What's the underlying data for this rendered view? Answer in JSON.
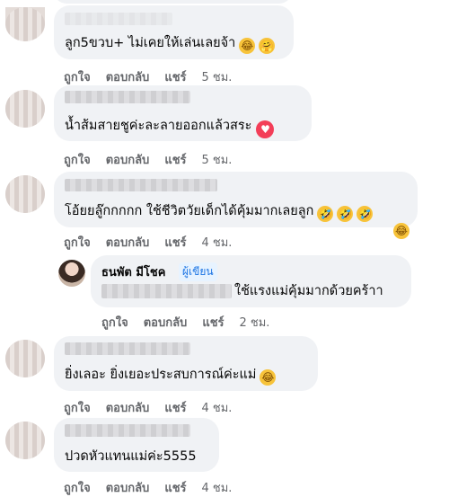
{
  "comments": [
    {
      "text": "ลูก5ขวบ+ ไม่เคยให้เล่นเลยจ้า",
      "emojis": [
        "laughing-face",
        "hugging-face"
      ],
      "actions": {
        "like": "ถูกใจ",
        "reply": "ตอบกลับ",
        "share": "แชร์",
        "time": "5 ชม."
      }
    },
    {
      "text": "น้ำส้มสายชูค่ะละลายออกแล้วสระ",
      "emojis": [
        "heart-reaction"
      ],
      "actions": {
        "like": "ถูกใจ",
        "reply": "ตอบกลับ",
        "share": "แชร์",
        "time": "5 ชม."
      }
    },
    {
      "text": "โอ้ยยลู๊กกกกก ใช้ชีวิตวัยเด็กได้คุ้มมากเลยลูก",
      "emojis": [
        "rolling-laughing-face",
        "rolling-laughing-face",
        "rolling-laughing-face",
        "laughing-face"
      ],
      "actions": {
        "like": "ถูกใจ",
        "reply": "ตอบกลับ",
        "share": "แชร์",
        "time": "4 ชม."
      }
    },
    {
      "text": "ยิ่งเลอะ ยิ่งเยอะประสบการณ์ค่ะแม่",
      "emojis": [
        "laughing-face"
      ],
      "actions": {
        "like": "ถูกใจ",
        "reply": "ตอบกลับ",
        "share": "แชร์",
        "time": "4 ชม."
      }
    },
    {
      "text": "ปวดหัวแทนแม่ค่ะ5555",
      "emojis": [],
      "actions": {
        "like": "ถูกใจ",
        "reply": "ตอบกลับ",
        "share": "แชร์",
        "time": "4 ชม."
      }
    }
  ],
  "reply": {
    "author": "ธนพัต มีโชค",
    "badge": "ผู้เขียน",
    "text": "ใช้แรงแม่คุ้มมากด้วยคร้าา",
    "actions": {
      "like": "ถูกใจ",
      "reply": "ตอบกลับ",
      "share": "แชร์",
      "time": "2 ชม."
    }
  }
}
